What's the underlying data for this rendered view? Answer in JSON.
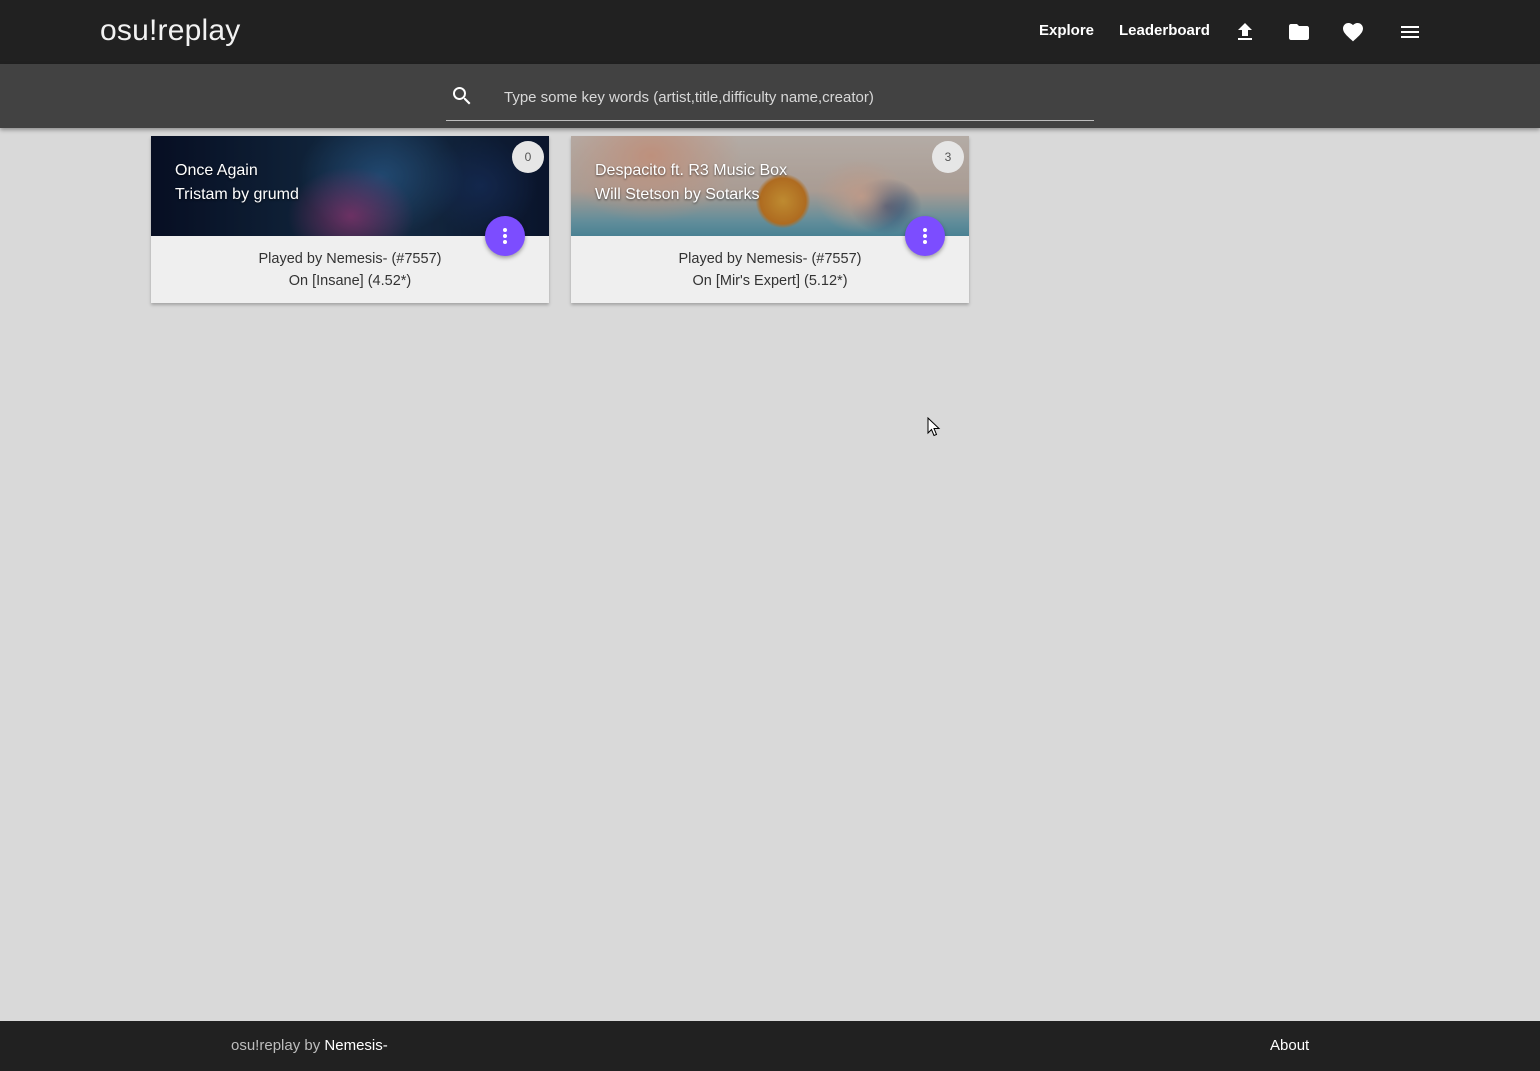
{
  "header": {
    "brand": "osu!replay",
    "nav": {
      "explore": "Explore",
      "leaderboard": "Leaderboard"
    },
    "icons": [
      "upload-icon",
      "folder-icon",
      "heart-icon",
      "menu-icon"
    ]
  },
  "search": {
    "placeholder": "Type some key words (artist,title,difficulty name,creator)",
    "value": ""
  },
  "cards": [
    {
      "title": "Once Again",
      "artist_line": "Tristam by grumd",
      "count": "0",
      "played_by": "Played by Nemesis- (#7557)",
      "difficulty": "On [Insane] (4.52*)"
    },
    {
      "title": "Despacito ft. R3 Music Box",
      "artist_line": "Will Stetson by Sotarks",
      "count": "3",
      "played_by": "Played by Nemesis- (#7557)",
      "difficulty": "On [Mir's Expert] (5.12*)"
    }
  ],
  "footer": {
    "brand": "osu!replay",
    "by": " by ",
    "author": "Nemesis-",
    "about": "About"
  },
  "colors": {
    "nav_bg": "#212121",
    "search_bg": "#424242",
    "page_bg": "#d9d9d9",
    "accent": "#7c4dff"
  }
}
